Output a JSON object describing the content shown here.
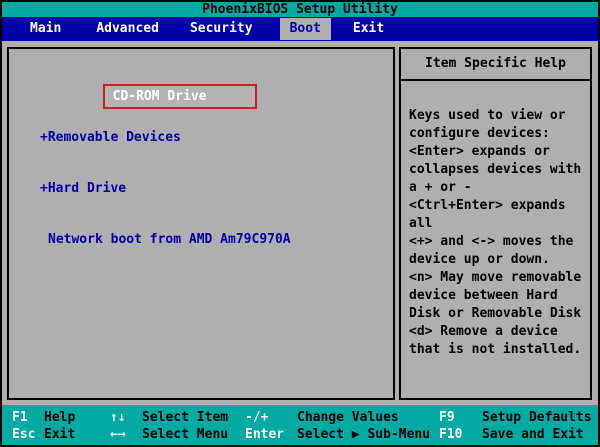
{
  "title_bar": {
    "title": "PhoenixBIOS Setup Utility"
  },
  "menu": {
    "tabs": [
      {
        "label": "Main",
        "active": false
      },
      {
        "label": "Advanced",
        "active": false
      },
      {
        "label": "Security",
        "active": false
      },
      {
        "label": "Boot",
        "active": true
      },
      {
        "label": "Exit",
        "active": false
      }
    ]
  },
  "boot": {
    "items": [
      {
        "label": "CD-ROM Drive",
        "selected": true,
        "annotated_with_red_box": true
      },
      {
        "label": "+Removable Devices",
        "selected": false
      },
      {
        "label": "+Hard Drive",
        "selected": false
      },
      {
        "label": "Network boot from AMD Am79C970A",
        "selected": false
      }
    ]
  },
  "help_panel": {
    "title": "Item Specific Help",
    "lines": [
      "Keys used to view or",
      "configure devices:",
      "<Enter> expands or",
      "collapses devices with",
      "a + or -",
      "<Ctrl+Enter> expands",
      "all",
      "<+> and <-> moves the",
      "device up or down.",
      "<n> May move removable",
      "device between Hard",
      "Disk or Removable Disk",
      "<d> Remove a device",
      "that is not installed."
    ]
  },
  "legend": {
    "rows": [
      [
        {
          "key": "F1",
          "label": "Help"
        },
        {
          "key": "↑↓",
          "label": "Select Item"
        },
        {
          "key": "-/+",
          "label": "Change Values"
        },
        {
          "key": "F9",
          "label": "Setup Defaults"
        }
      ],
      [
        {
          "key": "Esc",
          "label": "Exit"
        },
        {
          "key": "←→",
          "label": "Select Menu"
        },
        {
          "key": "Enter",
          "label": "Select ▶ Sub-Menu"
        },
        {
          "key": "F10",
          "label": "Save and Exit"
        }
      ]
    ]
  },
  "colors": {
    "teal_bar": "#00A9A2",
    "menu_blue": "#0000A8",
    "main_gray": "#AFAFAF",
    "item_text_blue": "#0000A8",
    "selected_item_text": "#FFFFFF",
    "annotation_red": "#CF1D1D",
    "key_text": "#FFFFFF",
    "label_text": "#000000"
  }
}
